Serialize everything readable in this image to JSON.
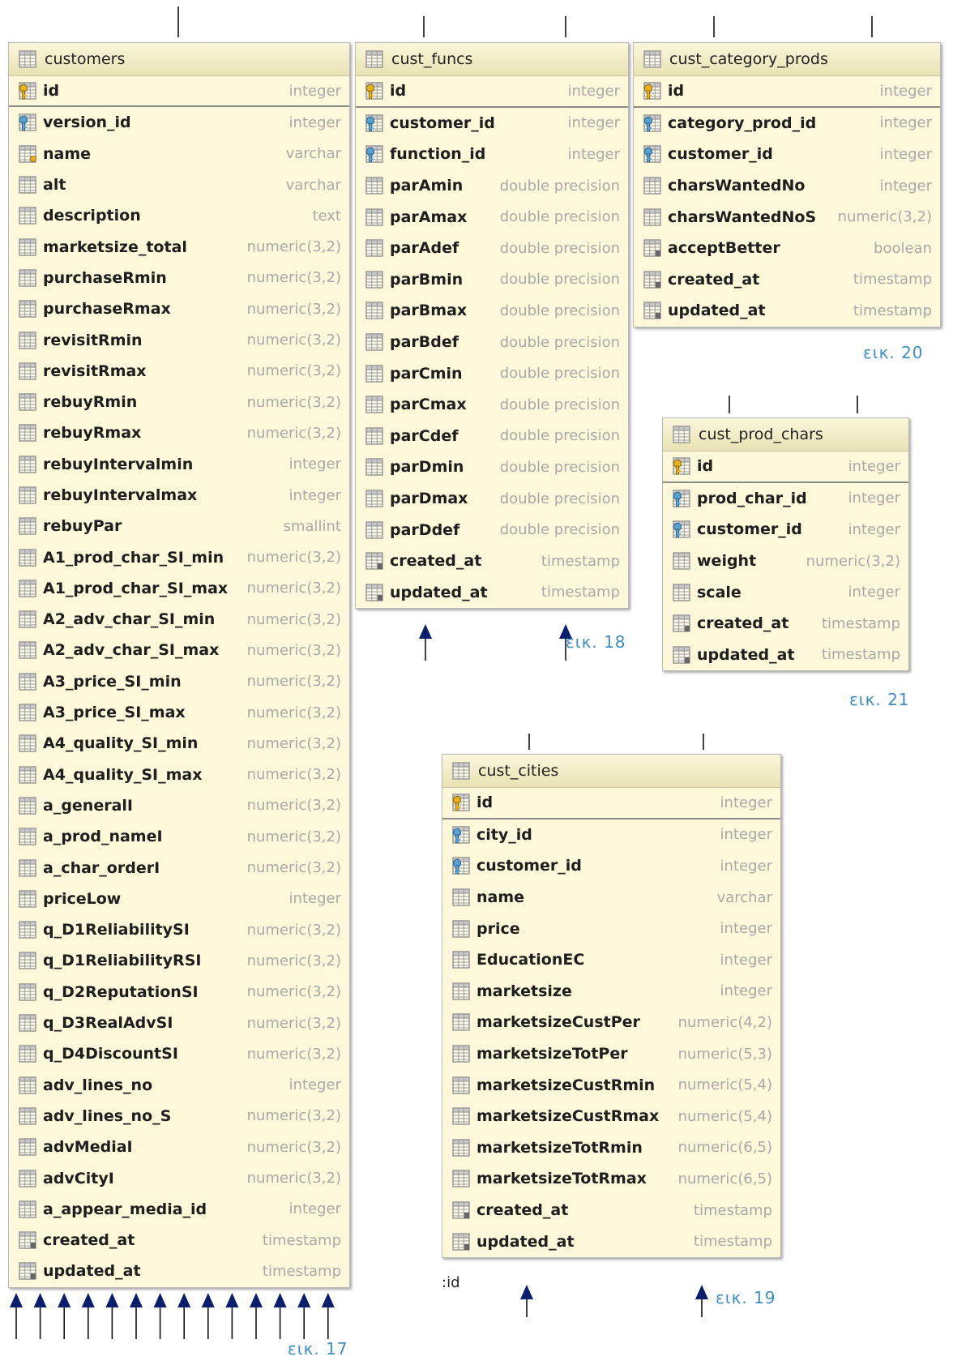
{
  "tables": [
    {
      "name": "customers",
      "caption": "εικ. 17",
      "rows": [
        {
          "name": "id",
          "type": "integer",
          "icon": "primary-key",
          "pk": true
        },
        {
          "name": "version_id",
          "type": "integer",
          "icon": "foreign-key"
        },
        {
          "name": "name",
          "type": "varchar",
          "icon": "indexed-column"
        },
        {
          "name": "alt",
          "type": "varchar",
          "icon": "column"
        },
        {
          "name": "description",
          "type": "text",
          "icon": "column"
        },
        {
          "name": "marketsize_total",
          "type": "numeric(3,2)",
          "icon": "column"
        },
        {
          "name": "purchaseRmin",
          "type": "numeric(3,2)",
          "icon": "column"
        },
        {
          "name": "purchaseRmax",
          "type": "numeric(3,2)",
          "icon": "column"
        },
        {
          "name": "revisitRmin",
          "type": "numeric(3,2)",
          "icon": "column"
        },
        {
          "name": "revisitRmax",
          "type": "numeric(3,2)",
          "icon": "column"
        },
        {
          "name": "rebuyRmin",
          "type": "numeric(3,2)",
          "icon": "column"
        },
        {
          "name": "rebuyRmax",
          "type": "numeric(3,2)",
          "icon": "column"
        },
        {
          "name": "rebuyIntervalmin",
          "type": "integer",
          "icon": "column"
        },
        {
          "name": "rebuyIntervalmax",
          "type": "integer",
          "icon": "column"
        },
        {
          "name": "rebuyPar",
          "type": "smallint",
          "icon": "column"
        },
        {
          "name": "A1_prod_char_SI_min",
          "type": "numeric(3,2)",
          "icon": "column"
        },
        {
          "name": "A1_prod_char_SI_max",
          "type": "numeric(3,2)",
          "icon": "column"
        },
        {
          "name": "A2_adv_char_SI_min",
          "type": "numeric(3,2)",
          "icon": "column"
        },
        {
          "name": "A2_adv_char_SI_max",
          "type": "numeric(3,2)",
          "icon": "column"
        },
        {
          "name": "A3_price_SI_min",
          "type": "numeric(3,2)",
          "icon": "column"
        },
        {
          "name": "A3_price_SI_max",
          "type": "numeric(3,2)",
          "icon": "column"
        },
        {
          "name": "A4_quality_SI_min",
          "type": "numeric(3,2)",
          "icon": "column"
        },
        {
          "name": "A4_quality_SI_max",
          "type": "numeric(3,2)",
          "icon": "column"
        },
        {
          "name": "a_generalI",
          "type": "numeric(3,2)",
          "icon": "column"
        },
        {
          "name": "a_prod_nameI",
          "type": "numeric(3,2)",
          "icon": "column"
        },
        {
          "name": "a_char_orderI",
          "type": "numeric(3,2)",
          "icon": "column"
        },
        {
          "name": "priceLow",
          "type": "integer",
          "icon": "column"
        },
        {
          "name": "q_D1ReliabilitySI",
          "type": "numeric(3,2)",
          "icon": "column"
        },
        {
          "name": "q_D1ReliabilityRSI",
          "type": "numeric(3,2)",
          "icon": "column"
        },
        {
          "name": "q_D2ReputationSI",
          "type": "numeric(3,2)",
          "icon": "column"
        },
        {
          "name": "q_D3RealAdvSI",
          "type": "numeric(3,2)",
          "icon": "column"
        },
        {
          "name": "q_D4DiscountSI",
          "type": "numeric(3,2)",
          "icon": "column"
        },
        {
          "name": "adv_lines_no",
          "type": "integer",
          "icon": "column"
        },
        {
          "name": "adv_lines_no_S",
          "type": "numeric(3,2)",
          "icon": "column"
        },
        {
          "name": "advMediaI",
          "type": "numeric(3,2)",
          "icon": "column"
        },
        {
          "name": "advCityI",
          "type": "numeric(3,2)",
          "icon": "column"
        },
        {
          "name": "a_appear_media_id",
          "type": "integer",
          "icon": "column"
        },
        {
          "name": "created_at",
          "type": "timestamp",
          "icon": "nullable-column"
        },
        {
          "name": "updated_at",
          "type": "timestamp",
          "icon": "nullable-column"
        }
      ]
    },
    {
      "name": "cust_funcs",
      "caption": "εικ. 18",
      "rows": [
        {
          "name": "id",
          "type": "integer",
          "icon": "primary-key",
          "pk": true
        },
        {
          "name": "customer_id",
          "type": "integer",
          "icon": "foreign-key"
        },
        {
          "name": "function_id",
          "type": "integer",
          "icon": "foreign-key"
        },
        {
          "name": "parAmin",
          "type": "double precision",
          "icon": "column"
        },
        {
          "name": "parAmax",
          "type": "double precision",
          "icon": "column"
        },
        {
          "name": "parAdef",
          "type": "double precision",
          "icon": "column"
        },
        {
          "name": "parBmin",
          "type": "double precision",
          "icon": "column"
        },
        {
          "name": "parBmax",
          "type": "double precision",
          "icon": "column"
        },
        {
          "name": "parBdef",
          "type": "double precision",
          "icon": "column"
        },
        {
          "name": "parCmin",
          "type": "double precision",
          "icon": "column"
        },
        {
          "name": "parCmax",
          "type": "double precision",
          "icon": "column"
        },
        {
          "name": "parCdef",
          "type": "double precision",
          "icon": "column"
        },
        {
          "name": "parDmin",
          "type": "double precision",
          "icon": "column"
        },
        {
          "name": "parDmax",
          "type": "double precision",
          "icon": "column"
        },
        {
          "name": "parDdef",
          "type": "double precision",
          "icon": "column"
        },
        {
          "name": "created_at",
          "type": "timestamp",
          "icon": "nullable-column"
        },
        {
          "name": "updated_at",
          "type": "timestamp",
          "icon": "nullable-column"
        }
      ]
    },
    {
      "name": "cust_category_prods",
      "caption": "εικ. 20",
      "rows": [
        {
          "name": "id",
          "type": "integer",
          "icon": "primary-key",
          "pk": true
        },
        {
          "name": "category_prod_id",
          "type": "integer",
          "icon": "foreign-key"
        },
        {
          "name": "customer_id",
          "type": "integer",
          "icon": "foreign-key"
        },
        {
          "name": "charsWantedNo",
          "type": "integer",
          "icon": "column"
        },
        {
          "name": "charsWantedNoS",
          "type": "numeric(3,2)",
          "icon": "column"
        },
        {
          "name": "acceptBetter",
          "type": "boolean",
          "icon": "nullable-column"
        },
        {
          "name": "created_at",
          "type": "timestamp",
          "icon": "nullable-column"
        },
        {
          "name": "updated_at",
          "type": "timestamp",
          "icon": "nullable-column"
        }
      ]
    },
    {
      "name": "cust_prod_chars",
      "caption": "εικ. 21",
      "rows": [
        {
          "name": "id",
          "type": "integer",
          "icon": "primary-key",
          "pk": true
        },
        {
          "name": "prod_char_id",
          "type": "integer",
          "icon": "foreign-key"
        },
        {
          "name": "customer_id",
          "type": "integer",
          "icon": "foreign-key"
        },
        {
          "name": "weight",
          "type": "numeric(3,2)",
          "icon": "column"
        },
        {
          "name": "scale",
          "type": "integer",
          "icon": "column"
        },
        {
          "name": "created_at",
          "type": "timestamp",
          "icon": "nullable-column"
        },
        {
          "name": "updated_at",
          "type": "timestamp",
          "icon": "nullable-column"
        }
      ]
    },
    {
      "name": "cust_cities",
      "caption": "εικ. 19",
      "rows": [
        {
          "name": "id",
          "type": "integer",
          "icon": "primary-key",
          "pk": true
        },
        {
          "name": "city_id",
          "type": "integer",
          "icon": "foreign-key"
        },
        {
          "name": "customer_id",
          "type": "integer",
          "icon": "foreign-key"
        },
        {
          "name": "name",
          "type": "varchar",
          "icon": "column"
        },
        {
          "name": "price",
          "type": "integer",
          "icon": "column"
        },
        {
          "name": "EducationEC",
          "type": "integer",
          "icon": "column"
        },
        {
          "name": "marketsize",
          "type": "integer",
          "icon": "column"
        },
        {
          "name": "marketsizeCustPer",
          "type": "numeric(4,2)",
          "icon": "column"
        },
        {
          "name": "marketsizeTotPer",
          "type": "numeric(5,3)",
          "icon": "column"
        },
        {
          "name": "marketsizeCustRmin",
          "type": "numeric(5,4)",
          "icon": "column"
        },
        {
          "name": "marketsizeCustRmax",
          "type": "numeric(5,4)",
          "icon": "column"
        },
        {
          "name": "marketsizeTotRmin",
          "type": "numeric(6,5)",
          "icon": "column"
        },
        {
          "name": "marketsizeTotRmax",
          "type": "numeric(6,5)",
          "icon": "column"
        },
        {
          "name": "created_at",
          "type": "timestamp",
          "icon": "nullable-column"
        },
        {
          "name": "updated_at",
          "type": "timestamp",
          "icon": "nullable-column"
        }
      ]
    }
  ],
  "stray_label": ":id",
  "colors": {
    "table_fill": "#fcf8d9",
    "caption": "#3d8ec4",
    "arrow": "#0a1e6e",
    "type_text": "#a9a9a9"
  }
}
